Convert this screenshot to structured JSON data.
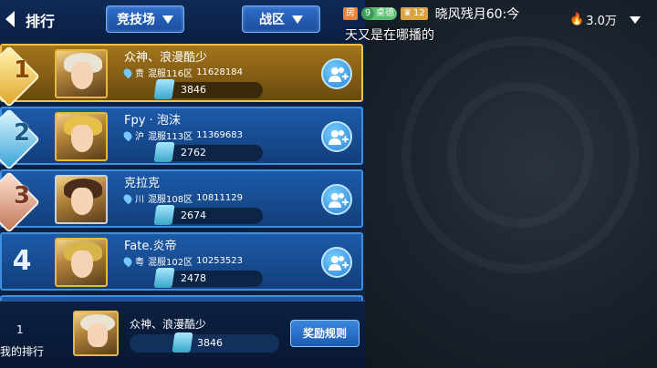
{
  "header": {
    "title": "排行",
    "dropdown_mode": "竞技场",
    "dropdown_region": "战区"
  },
  "rows": [
    {
      "rank": "1",
      "name": "众神、浪漫酷少",
      "region": "贵",
      "server": "混服116区",
      "id": "11628184",
      "score": "3846",
      "style": "gold"
    },
    {
      "rank": "2",
      "name": "Fpy · 泡沫",
      "region": "沪",
      "server": "混服113区",
      "id": "11369683",
      "score": "2762",
      "style": "blue"
    },
    {
      "rank": "3",
      "name": "克拉克",
      "region": "川",
      "server": "混服108区",
      "id": "10811129",
      "score": "2674",
      "style": "blue"
    },
    {
      "rank": "4",
      "name": "Fate.炎帝",
      "region": "粤",
      "server": "混服102区",
      "id": "10253523",
      "score": "2478",
      "style": "blue"
    }
  ],
  "my_rank": {
    "rank": "1",
    "label": "我的排行",
    "name": "众神、浪漫酷少",
    "score": "3846",
    "reward_button": "奖励规则"
  },
  "live": {
    "room_badge": "房",
    "fans_level": "9",
    "fans_name": "桌德",
    "user_level": "12",
    "streamer_message": "晓风残月60:今",
    "heat": "3.0万",
    "danmaku": "天又是在哪播的"
  },
  "colors": {
    "gold_row": "#a3751c",
    "blue_row": "#1d5aa8",
    "accent": "#3f8fe0"
  }
}
